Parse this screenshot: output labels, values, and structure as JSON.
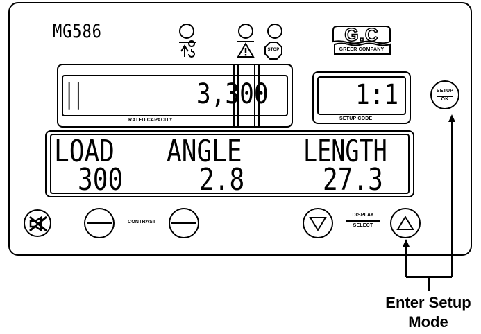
{
  "model": "MG586",
  "logo": {
    "text": "G.C",
    "subtext": "GREER COMPANY"
  },
  "lamps": {
    "stop_label": "STOP"
  },
  "rated_capacity": {
    "value": "3,300",
    "bar_glyph": "||",
    "label": "RATED CAPACITY"
  },
  "setup_code": {
    "value": "1:1",
    "label": "SETUP CODE"
  },
  "setup_button": {
    "line1": "SETUP",
    "line2": "OK"
  },
  "main_display": {
    "headers": [
      "LOAD",
      "ANGLE",
      "LENGTH"
    ],
    "values": [
      "300",
      "2.8",
      "27.3"
    ]
  },
  "contrast_label": "CONTRAST",
  "display_select": {
    "line1": "DISPLAY",
    "line2": "SELECT"
  },
  "annotation": {
    "line1": "Enter Setup",
    "line2": "Mode"
  }
}
